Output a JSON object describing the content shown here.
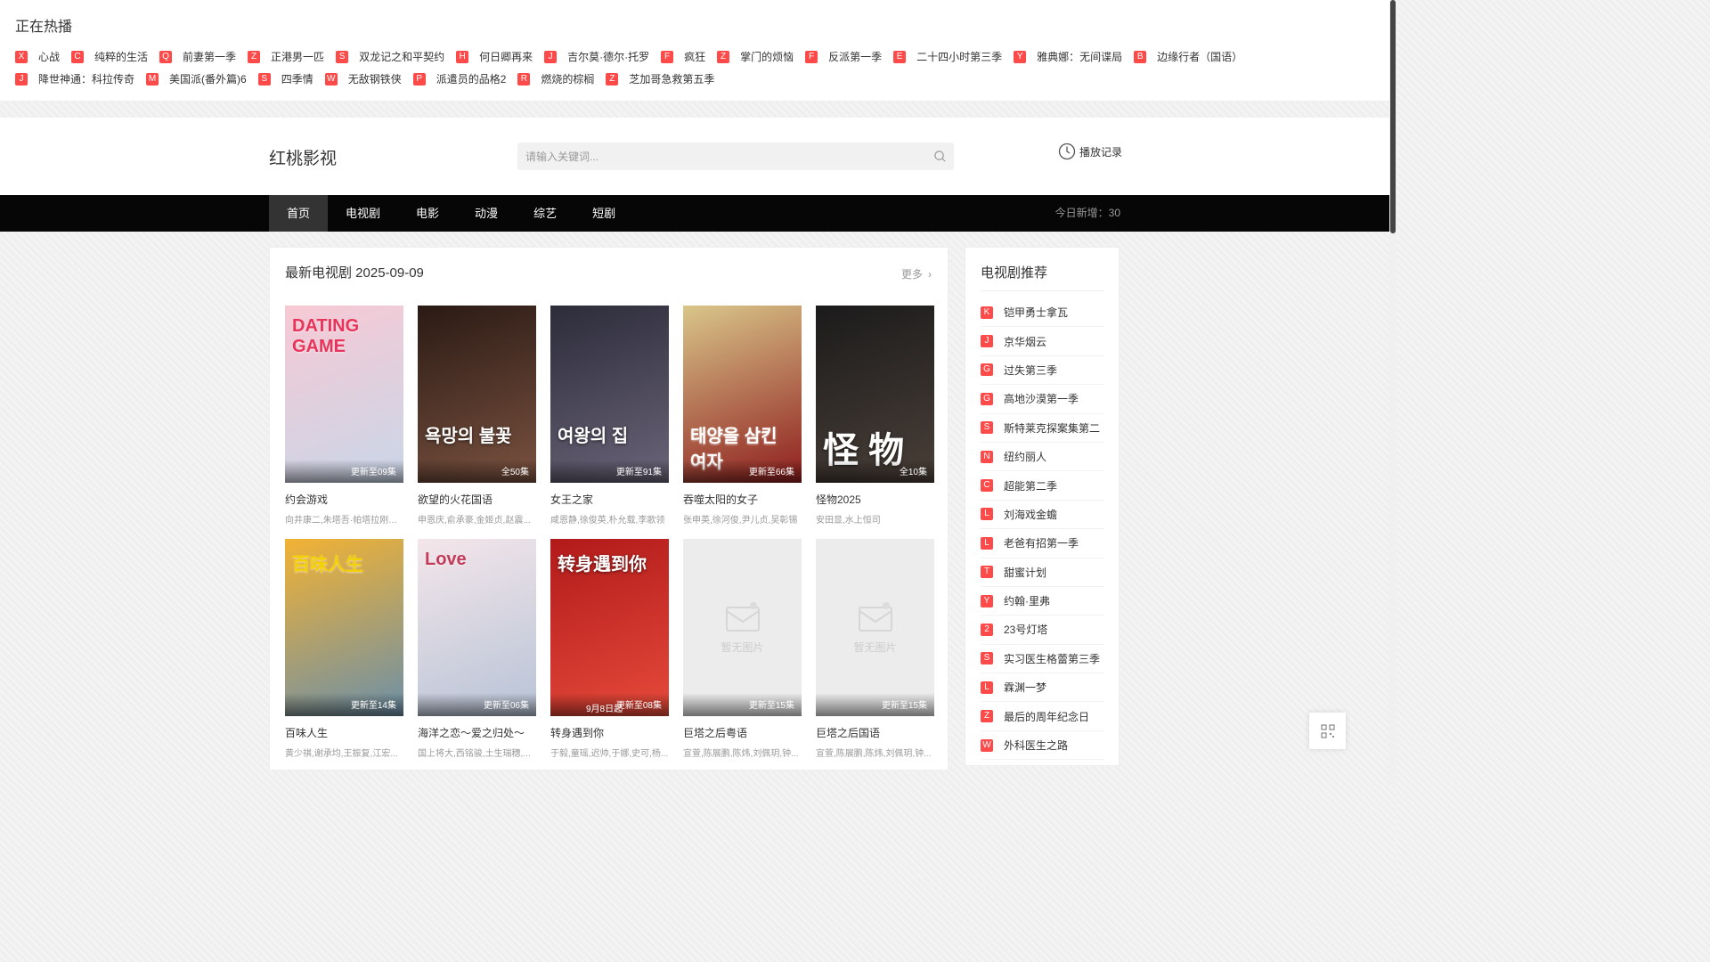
{
  "hot": {
    "title": "正在热播",
    "items": [
      {
        "badge": "X",
        "title": "心战"
      },
      {
        "badge": "C",
        "title": "纯粹的生活"
      },
      {
        "badge": "Q",
        "title": "前妻第一季"
      },
      {
        "badge": "Z",
        "title": "正港男一匹"
      },
      {
        "badge": "S",
        "title": "双龙记之和平契约"
      },
      {
        "badge": "H",
        "title": "何日卿再来"
      },
      {
        "badge": "J",
        "title": "吉尔莫·德尔·托罗"
      },
      {
        "badge": "F",
        "title": "疯狂"
      },
      {
        "badge": "Z",
        "title": "掌门的烦恼"
      },
      {
        "badge": "F",
        "title": "反派第一季"
      },
      {
        "badge": "E",
        "title": "二十四小时第三季"
      },
      {
        "badge": "Y",
        "title": "雅典娜：无间谍局"
      },
      {
        "badge": "B",
        "title": "边缘行者（国语）"
      },
      {
        "badge": "J",
        "title": "降世神通：科拉传奇"
      },
      {
        "badge": "M",
        "title": "美国派(番外篇)6"
      },
      {
        "badge": "S",
        "title": "四季情"
      },
      {
        "badge": "W",
        "title": "无敌钢铁侠"
      },
      {
        "badge": "P",
        "title": "派遣员的品格2"
      },
      {
        "badge": "R",
        "title": "燃烧的棕榈"
      },
      {
        "badge": "Z",
        "title": "芝加哥急救第五季"
      }
    ]
  },
  "header": {
    "logo": "红桃影视",
    "search_placeholder": "请输入关键词...",
    "history_label": "播放记录"
  },
  "nav": {
    "items": [
      "首页",
      "电视剧",
      "电影",
      "动漫",
      "综艺",
      "短剧"
    ],
    "active_index": 0,
    "today_new": "今日新增：30"
  },
  "main": {
    "title": "最新电视剧 2025-09-09",
    "more_label": "更多",
    "no_image_text": "暂无图片",
    "cards": [
      {
        "title": "约会游戏",
        "status": "更新至09集",
        "cast": "向井康二,朱塔吾·帕塔拉刚普...",
        "poster_text": "DATING GAME",
        "colors": [
          "#f7c9d4",
          "#c9d6e8"
        ]
      },
      {
        "title": "欲望的火花国语",
        "status": "全50集",
        "cast": "申恩庆,俞承豪,金姬贞,赵震...",
        "poster_text": "욕망의 불꽃",
        "colors": [
          "#2a1a14",
          "#7a5240"
        ]
      },
      {
        "title": "女王之家",
        "status": "更新至91集",
        "cast": "咸恩静,徐俊英,朴允载,李歌领",
        "poster_text": "여왕의 집",
        "colors": [
          "#2c2c3a",
          "#6a6478"
        ]
      },
      {
        "title": "吞噬太阳的女子",
        "status": "更新至66集",
        "cast": "张申英,徐河俊,尹儿贞,吴彰锡",
        "poster_text": "태양을 삼킨 여자",
        "colors": [
          "#d9c68a",
          "#8e1d1d"
        ]
      },
      {
        "title": "怪物2025",
        "status": "全10集",
        "cast": "安田显,水上恒司",
        "poster_text": "怪 物",
        "colors": [
          "#1b1b1b",
          "#4a3f38"
        ]
      },
      {
        "title": "百味人生",
        "status": "更新至14集",
        "cast": "黄少祺,谢承均,王振复,江宏...",
        "poster_text": "百味人生",
        "colors": [
          "#f2b233",
          "#6c8fa8"
        ]
      },
      {
        "title": "海洋之恋～爱之归处～",
        "status": "更新至06集",
        "cast": "国上将大,西铭骏,土生瑞穗,...",
        "poster_text": "Love",
        "colors": [
          "#f4e6ea",
          "#b7c3d6"
        ]
      },
      {
        "title": "转身遇到你",
        "status": "更新至08集",
        "cast": "于毅,童瑶,迟帅,于娜,史可,杨...",
        "poster_text": "转身遇到你",
        "colors": [
          "#b11a1a",
          "#e64a3a"
        ],
        "extra_label": "9月8日起"
      },
      {
        "title": "巨塔之后粤语",
        "status": "更新至15集",
        "cast": "宣萱,陈展鹏,陈炜,刘佩玥,钟...",
        "no_image": true
      },
      {
        "title": "巨塔之后国语",
        "status": "更新至15集",
        "cast": "宣萱,陈展鹏,陈炜,刘佩玥,钟...",
        "no_image": true
      }
    ]
  },
  "sidebar": {
    "title": "电视剧推荐",
    "items": [
      {
        "badge": "K",
        "title": "铠甲勇士拿瓦"
      },
      {
        "badge": "J",
        "title": "京华烟云"
      },
      {
        "badge": "G",
        "title": "过失第三季"
      },
      {
        "badge": "G",
        "title": "高地沙漠第一季"
      },
      {
        "badge": "S",
        "title": "斯特莱克探案集第二"
      },
      {
        "badge": "N",
        "title": "纽约丽人"
      },
      {
        "badge": "C",
        "title": "超能第二季"
      },
      {
        "badge": "L",
        "title": "刘海戏金蟾"
      },
      {
        "badge": "L",
        "title": "老爸有招第一季"
      },
      {
        "badge": "T",
        "title": "甜蜜计划"
      },
      {
        "badge": "Y",
        "title": "约翰·里弗"
      },
      {
        "badge": "2",
        "title": "23号灯塔"
      },
      {
        "badge": "S",
        "title": "实习医生格蕾第三季"
      },
      {
        "badge": "L",
        "title": "霖渊一梦"
      },
      {
        "badge": "Z",
        "title": "最后的周年纪念日"
      },
      {
        "badge": "W",
        "title": "外科医生之路"
      }
    ]
  },
  "colors": {
    "badge": "#ff4a4a",
    "nav_bg": "#060606",
    "nav_active": "#333333"
  }
}
